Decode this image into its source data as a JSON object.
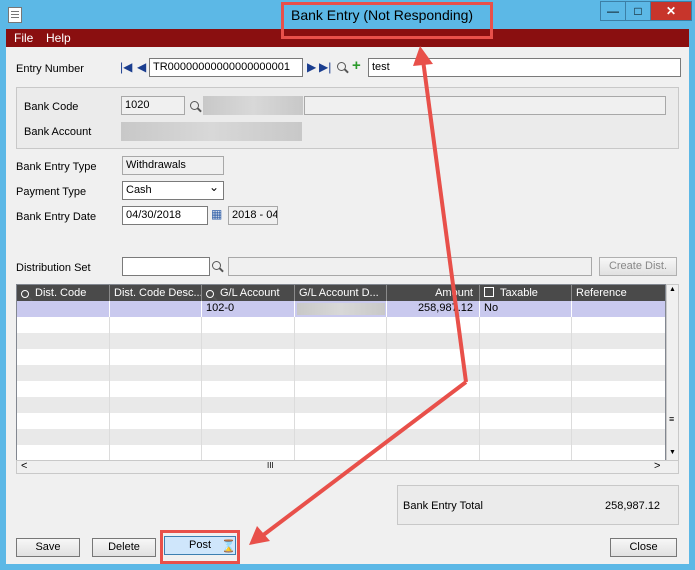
{
  "window": {
    "title": "Bank Entry (Not Responding)",
    "minimize": "—",
    "maximize": "□",
    "close": "✕"
  },
  "menu": {
    "items": [
      "File",
      "Help"
    ]
  },
  "entry": {
    "label": "Entry Number",
    "value": "TR00000000000000000001",
    "description": "test",
    "nav_first": "|◀",
    "nav_prev": "◀",
    "nav_next": "▶",
    "nav_last": "▶|",
    "add": "+"
  },
  "bank": {
    "code_label": "Bank Code",
    "code_value": "1020",
    "account_label": "Bank Account"
  },
  "entry_type": {
    "label": "Bank Entry Type",
    "value": "Withdrawals"
  },
  "payment_type": {
    "label": "Payment Type",
    "value": "Cash",
    "arrow": "⌄"
  },
  "entry_date": {
    "label": "Bank Entry Date",
    "value": "04/30/2018",
    "period": "2018 - 04",
    "calendar": "▦"
  },
  "distribution": {
    "label": "Distribution Set",
    "create_label": "Create Dist."
  },
  "grid": {
    "columns": [
      "Dist. Code",
      "Dist. Code Desc...",
      "G/L Account",
      "G/L Account D...",
      "Amount",
      "Taxable",
      "Reference"
    ],
    "rows": [
      {
        "dist_code": "",
        "dist_desc": "",
        "gl_account": "102-0",
        "gl_desc": "",
        "amount": "258,987.12",
        "taxable": "No",
        "reference": ""
      }
    ],
    "scroll_left": "<",
    "scroll_right": ">",
    "scroll_thumb": "III",
    "scroll_up": "▲",
    "scroll_down": "▼"
  },
  "total": {
    "label": "Bank Entry Total",
    "value": "258,987.12"
  },
  "buttons": {
    "save": "Save",
    "delete": "Delete",
    "post": "Post",
    "close": "Close",
    "busy": "⌛"
  },
  "annotation": {
    "color": "#e8504a"
  }
}
